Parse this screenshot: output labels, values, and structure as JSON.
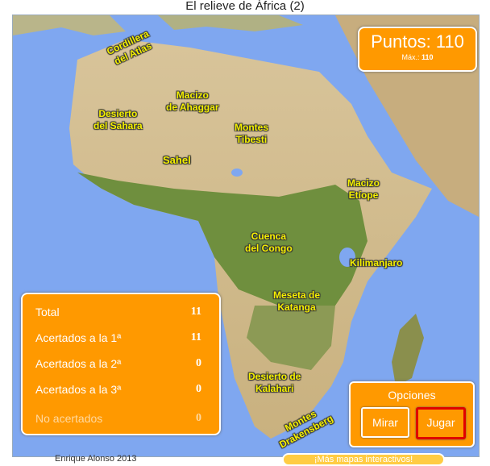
{
  "title": "El relieve de África (2)",
  "score": {
    "label": "Puntos: 110",
    "max_label": "Máx.:",
    "max_value": "110"
  },
  "map_labels": [
    {
      "id": "cordillera-atlas",
      "text": "Cordillera\ndel Atlas"
    },
    {
      "id": "desierto-sahara",
      "text": "Desierto\ndel Sahara"
    },
    {
      "id": "macizo-ahaggar",
      "text": "Macizo\nde Ahaggar"
    },
    {
      "id": "montes-tibesti",
      "text": "Montes\nTibesti"
    },
    {
      "id": "sahel",
      "text": "Sahel"
    },
    {
      "id": "macizo-etiope",
      "text": "Macizo\nEtíope"
    },
    {
      "id": "cuenca-congo",
      "text": "Cuenca\ndel Congo"
    },
    {
      "id": "kilimanjaro",
      "text": "Kilimanjaro"
    },
    {
      "id": "meseta-katanga",
      "text": "Meseta de\nKatanga"
    },
    {
      "id": "desierto-kalahari",
      "text": "Desierto de\nKalahari"
    },
    {
      "id": "montes-drakensberg",
      "text": "Montes\nDrakensberg"
    }
  ],
  "stats": {
    "total_label": "Total",
    "total_value": "11",
    "first_label": "Acertados a la 1ª",
    "first_value": "11",
    "second_label": "Acertados a la 2ª",
    "second_value": "0",
    "third_label": "Acertados a la 3ª",
    "third_value": "0",
    "wrong_label": "No acertados",
    "wrong_value": "0"
  },
  "options": {
    "header": "Opciones",
    "look_label": "Mirar",
    "play_label": "Jugar"
  },
  "footer": "Enrique Alonso 2013",
  "more_link": "¡Más mapas interactivos!",
  "colors": {
    "panel": "#ff9900",
    "sea": "#7fa7f0",
    "label_text": "#f5f000",
    "active_border": "#e00000"
  }
}
